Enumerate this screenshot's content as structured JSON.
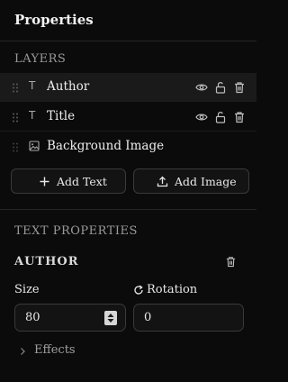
{
  "panel": {
    "title": "Properties"
  },
  "layers": {
    "section_label": "LAYERS",
    "items": [
      {
        "name": "Author",
        "type_icon": "text-type-icon",
        "active": true,
        "actions": [
          "eye-icon",
          "unlock-icon",
          "trash-icon"
        ]
      },
      {
        "name": "Title",
        "type_icon": "text-type-icon",
        "active": false,
        "actions": [
          "eye-icon",
          "unlock-icon",
          "trash-icon"
        ]
      },
      {
        "name": "Background Image",
        "type_icon": "image-type-icon",
        "active": false,
        "actions": []
      }
    ],
    "add_text_label": "Add Text",
    "add_image_label": "Add Image"
  },
  "text_properties": {
    "section_label": "TEXT PROPERTIES",
    "selected_layer_title": "AUTHOR",
    "size_label": "Size",
    "size_value": "80",
    "rotation_label": "Rotation",
    "rotation_value": "0",
    "effects_label": "Effects"
  },
  "colors": {
    "background": "#0b0b0b",
    "active_row": "#1a1a1a",
    "border": "#3a3a3a",
    "text": "#e8e8e8",
    "muted": "#9a9a9a"
  }
}
